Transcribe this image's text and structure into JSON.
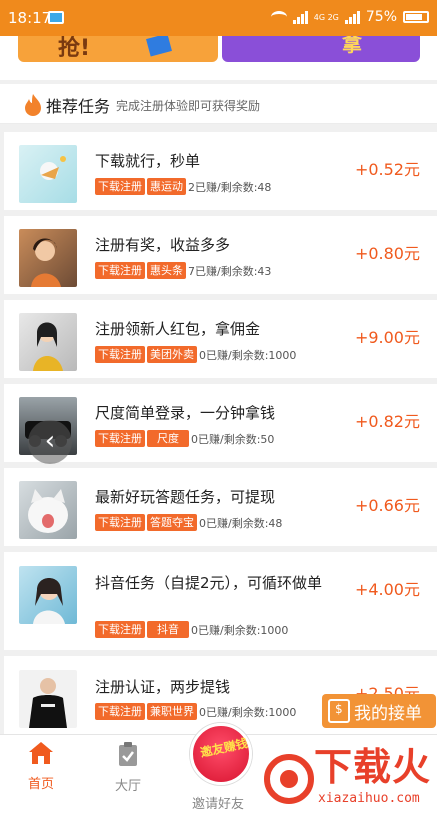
{
  "status_bar": {
    "time": "18:17",
    "network": "4G 2G",
    "battery": "75%"
  },
  "banners": {
    "left_text": "抢!",
    "right_text": "拿"
  },
  "section": {
    "title": "推荐任务",
    "subtitle": "完成注册体验即可获得奖励"
  },
  "tasks": [
    {
      "title": "下载就行，秒单",
      "tags": [
        "下载注册",
        "惠运动"
      ],
      "stats": "2已赚/剩余数:48",
      "reward": "+0.52元",
      "thumb": "bird-illustration"
    },
    {
      "title": "注册有奖，收益多多",
      "tags": [
        "下载注册",
        "惠头条"
      ],
      "stats": "7已赚/剩余数:43",
      "reward": "+0.80元",
      "thumb": "woman-portrait"
    },
    {
      "title": "注册领新人红包，拿佣金",
      "tags": [
        "下载注册",
        "美团外卖"
      ],
      "stats": "0已赚/剩余数:1000",
      "reward": "+9.00元",
      "thumb": "girl-yellow-sweater"
    },
    {
      "title": "尺度简单登录，一分钟拿钱",
      "tags": [
        "下载注册",
        "尺度"
      ],
      "stats": "0已赚/剩余数:50",
      "reward": "+0.82元",
      "thumb": "car-photo"
    },
    {
      "title": "最新好玩答题任务，可提现",
      "tags": [
        "下载注册",
        "答题夺宝"
      ],
      "stats": "0已赚/剩余数:48",
      "reward": "+0.66元",
      "thumb": "white-cat"
    },
    {
      "title": "抖音任务（自提2元），可循环做单",
      "tags": [
        "下载注册",
        "抖音"
      ],
      "stats": "0已赚/剩余数:1000",
      "reward": "+4.00元",
      "thumb": "smiling-woman"
    },
    {
      "title": "注册认证，两步提钱",
      "tags": [
        "下载注册",
        "兼职世界"
      ],
      "stats": "0已赚/剩余数:1000",
      "reward": "+2.50元",
      "thumb": "man-black-shirt"
    }
  ],
  "floating": {
    "my_orders": "我的接单"
  },
  "nav": {
    "home": "首页",
    "hall": "大厅",
    "invite": "邀请好友",
    "invite_badge": "邀友赚钱"
  },
  "watermark": {
    "brand": "下载火",
    "url": "xiazaihuo.com"
  },
  "colors": {
    "accent": "#f05a1e",
    "status_bar": "#f08a1c",
    "tag": "#f26a2b"
  }
}
